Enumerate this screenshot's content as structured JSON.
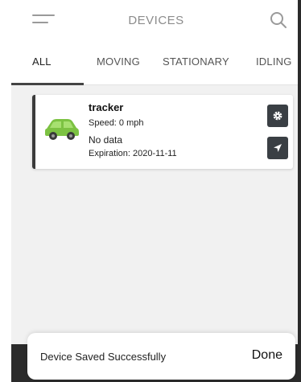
{
  "header": {
    "title": "DEVICES",
    "menu_icon": "hamburger-menu-icon",
    "search_icon": "search-icon"
  },
  "tabs": [
    {
      "label": "ALL",
      "active": true
    },
    {
      "label": "MOVING",
      "active": false
    },
    {
      "label": "STATIONARY",
      "active": false
    },
    {
      "label": "IDLING",
      "active": false
    }
  ],
  "devices": [
    {
      "name": "tracker",
      "speed": "Speed: 0 mph",
      "status": "No data",
      "expiration": "Expiration: 2020-11-11",
      "icon": "car-icon",
      "icon_color": "#7cc242",
      "actions": [
        "gear-icon",
        "locate-arrow-icon"
      ]
    }
  ],
  "snackbar": {
    "message": "Device Saved Successfully",
    "action": "Done"
  },
  "colors": {
    "accent_dark": "#3a3f44",
    "car_green": "#7cc242"
  }
}
